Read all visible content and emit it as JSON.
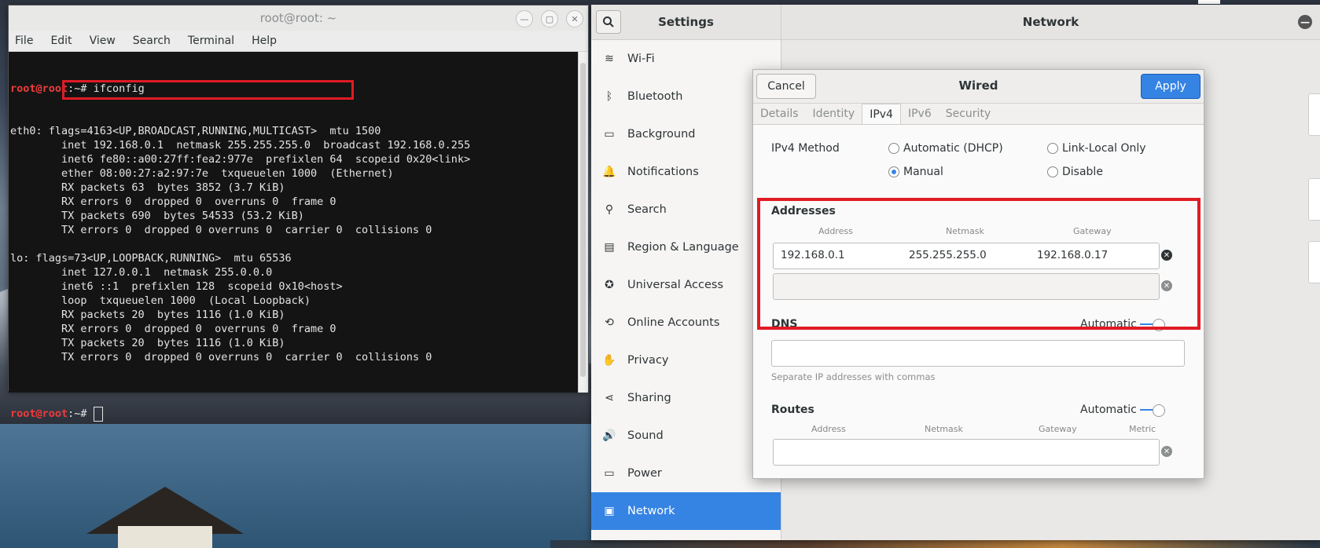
{
  "terminal": {
    "title": "root@root: ~",
    "menu": [
      "File",
      "Edit",
      "View",
      "Search",
      "Terminal",
      "Help"
    ],
    "prompt": "root@root",
    "prompt_suffix": ":~# ",
    "command": "ifconfig",
    "output": [
      "eth0: flags=4163<UP,BROADCAST,RUNNING,MULTICAST>  mtu 1500",
      "        inet 192.168.0.1  netmask 255.255.255.0  broadcast 192.168.0.255",
      "        inet6 fe80::a00:27ff:fea2:977e  prefixlen 64  scopeid 0x20<link>",
      "        ether 08:00:27:a2:97:7e  txqueuelen 1000  (Ethernet)",
      "        RX packets 63  bytes 3852 (3.7 KiB)",
      "        RX errors 0  dropped 0  overruns 0  frame 0",
      "        TX packets 690  bytes 54533 (53.2 KiB)",
      "        TX errors 0  dropped 0 overruns 0  carrier 0  collisions 0",
      "",
      "lo: flags=73<UP,LOOPBACK,RUNNING>  mtu 65536",
      "        inet 127.0.0.1  netmask 255.0.0.0",
      "        inet6 ::1  prefixlen 128  scopeid 0x10<host>",
      "        loop  txqueuelen 1000  (Local Loopback)",
      "        RX packets 20  bytes 1116 (1.0 KiB)",
      "        RX errors 0  dropped 0  overruns 0  frame 0",
      "        TX packets 20  bytes 1116 (1.0 KiB)",
      "        TX errors 0  dropped 0 overruns 0  carrier 0  collisions 0",
      ""
    ]
  },
  "settings": {
    "title": "Settings",
    "panel_title": "Network",
    "sidebar": [
      {
        "label": "Wi-Fi",
        "icon": "wifi-icon",
        "glyph": "≋"
      },
      {
        "label": "Bluetooth",
        "icon": "bluetooth-icon",
        "glyph": "ᛒ"
      },
      {
        "label": "Background",
        "icon": "background-icon",
        "glyph": "▭"
      },
      {
        "label": "Notifications",
        "icon": "bell-icon",
        "glyph": "🔔"
      },
      {
        "label": "Search",
        "icon": "search-icon",
        "glyph": "⚲"
      },
      {
        "label": "Region & Language",
        "icon": "region-icon",
        "glyph": "▤"
      },
      {
        "label": "Universal Access",
        "icon": "universal-access-icon",
        "glyph": "✪"
      },
      {
        "label": "Online Accounts",
        "icon": "online-accounts-icon",
        "glyph": "⟲"
      },
      {
        "label": "Privacy",
        "icon": "privacy-hand-icon",
        "glyph": "✋"
      },
      {
        "label": "Sharing",
        "icon": "sharing-icon",
        "glyph": "⋖"
      },
      {
        "label": "Sound",
        "icon": "speaker-icon",
        "glyph": "🔊"
      },
      {
        "label": "Power",
        "icon": "power-icon",
        "glyph": "▭"
      },
      {
        "label": "Network",
        "icon": "network-icon",
        "glyph": "▣",
        "active": true
      }
    ]
  },
  "dialog": {
    "title": "Wired",
    "cancel": "Cancel",
    "apply": "Apply",
    "tabs": [
      {
        "label": "Details"
      },
      {
        "label": "Identity"
      },
      {
        "label": "IPv4",
        "active": true
      },
      {
        "label": "IPv6"
      },
      {
        "label": "Security"
      }
    ],
    "ipv4_method_label": "IPv4 Method",
    "methods": {
      "automatic": "Automatic (DHCP)",
      "link_local": "Link-Local Only",
      "manual": "Manual",
      "disable": "Disable",
      "selected": "Manual"
    },
    "addresses_label": "Addresses",
    "columns": {
      "address": "Address",
      "netmask": "Netmask",
      "gateway": "Gateway",
      "metric": "Metric"
    },
    "address_rows": [
      {
        "address": "192.168.0.1",
        "netmask": "255.255.255.0",
        "gateway": "192.168.0.17"
      }
    ],
    "dns_label": "DNS",
    "automatic_label": "Automatic",
    "dns_value": "",
    "dns_hint": "Separate IP addresses with commas",
    "routes_label": "Routes",
    "routes_automatic_label": "Automatic"
  },
  "colors": {
    "accent": "#3584e4",
    "highlight": "#e01b24",
    "prompt": "#ee3b3b"
  }
}
